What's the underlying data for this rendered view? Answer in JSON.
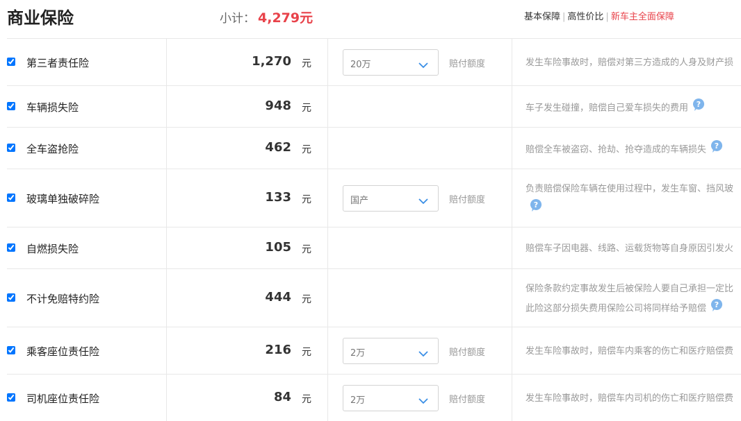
{
  "header": {
    "title": "商业保险",
    "subtotal_label": "小计：",
    "subtotal_value": "4,279元",
    "tabs": [
      {
        "label": "基本保障",
        "active": false
      },
      {
        "label": "高性价比",
        "active": false
      },
      {
        "label": "新车主全面保障",
        "active": true
      }
    ]
  },
  "colors": {
    "accent": "#e8424a",
    "chevron": "#3a8ee6",
    "help_icon": "#7fb5ec"
  },
  "unit": "元",
  "rows": [
    {
      "name": "第三者责任险",
      "price": "1,270",
      "select": "20万",
      "option_label": "赔付额度",
      "desc": [
        "发生车险事故时，赔偿对第三方造成的人身及财产损"
      ],
      "help": false
    },
    {
      "name": "车辆损失险",
      "price": "948",
      "desc": [
        "车子发生碰撞，赔偿自己爱车损失的费用"
      ],
      "help": true
    },
    {
      "name": "全车盗抢险",
      "price": "462",
      "desc": [
        "赔偿全车被盗窃、抢劫、抢夺造成的车辆损失"
      ],
      "help": true
    },
    {
      "name": "玻璃单独破碎险",
      "price": "133",
      "select": "国产",
      "option_label": "赔付额度",
      "desc": [
        "负责赔偿保险车辆在使用过程中，发生车窗、挡风玻",
        ""
      ],
      "help": true
    },
    {
      "name": "自燃损失险",
      "price": "105",
      "desc": [
        "赔偿车子因电器、线路、运载货物等自身原因引发火"
      ],
      "help": false
    },
    {
      "name": "不计免赔特约险",
      "price": "444",
      "desc": [
        "保险条款约定事故发生后被保险人要自己承担一定比",
        "此险这部分损失费用保险公司将同样给予赔偿"
      ],
      "help": true
    },
    {
      "name": "乘客座位责任险",
      "price": "216",
      "select": "2万",
      "option_label": "赔付额度",
      "desc": [
        "发生车险事故时，赔偿车内乘客的伤亡和医疗赔偿费"
      ],
      "help": false
    },
    {
      "name": "司机座位责任险",
      "price": "84",
      "select": "2万",
      "option_label": "赔付额度",
      "desc": [
        "发生车险事故时，赔偿车内司机的伤亡和医疗赔偿费"
      ],
      "help": false
    }
  ]
}
